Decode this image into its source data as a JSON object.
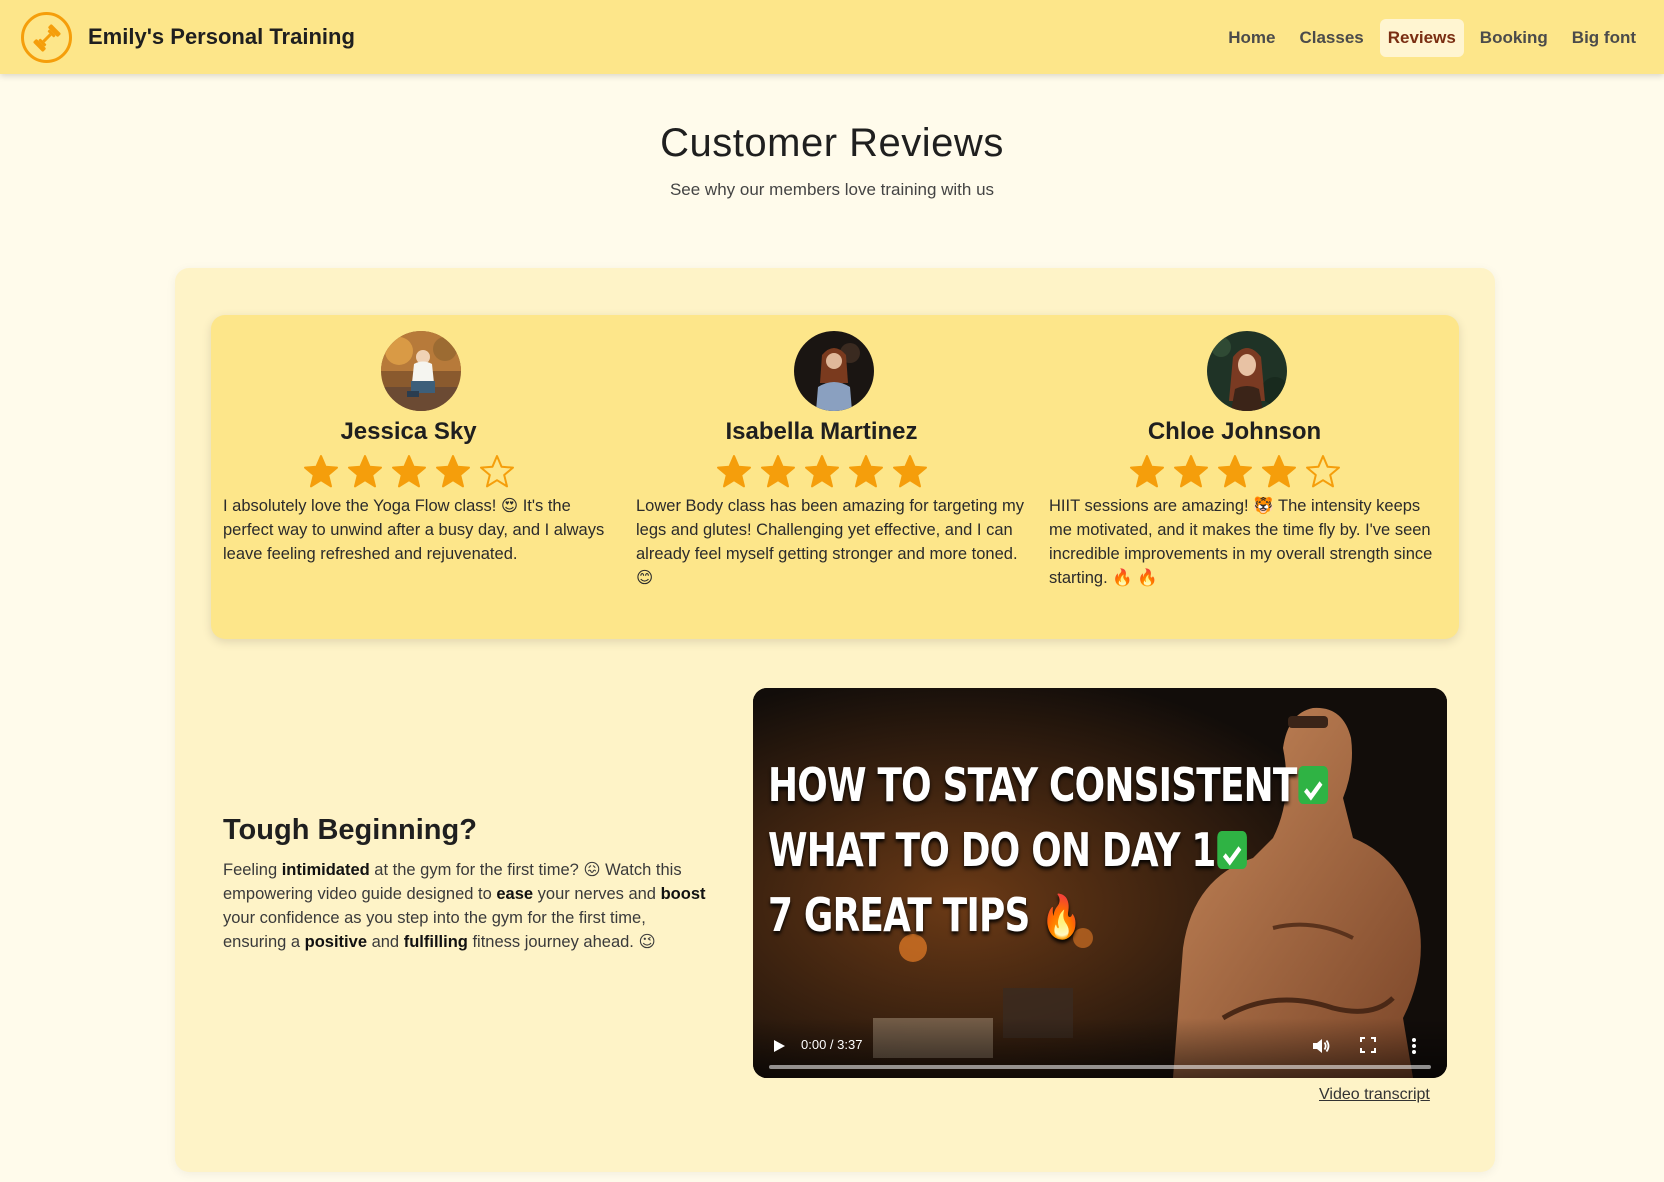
{
  "navbar": {
    "brand": "Emily's Personal Training",
    "links": [
      {
        "label": "Home",
        "active": false
      },
      {
        "label": "Classes",
        "active": false
      },
      {
        "label": "Reviews",
        "active": true
      },
      {
        "label": "Booking",
        "active": false
      },
      {
        "label": "Big font",
        "active": false
      }
    ]
  },
  "header": {
    "title": "Customer Reviews",
    "subtitle": "See why our members love training with us"
  },
  "reviews": [
    {
      "name": "Jessica Sky",
      "rating": 4,
      "max_rating": 5,
      "text": "I absolutely love the Yoga Flow class! 😍 It's the perfect way to unwind after a busy day, and I always leave feeling refreshed and rejuvenated."
    },
    {
      "name": "Isabella Martinez",
      "rating": 5,
      "max_rating": 5,
      "text": "Lower Body class has been amazing for targeting my legs and glutes! Challenging yet effective, and I can already feel myself getting stronger and more toned. 😊"
    },
    {
      "name": "Chloe Johnson",
      "rating": 4,
      "max_rating": 5,
      "text": "HIIT sessions are amazing! 🐯 The intensity keeps me motivated, and it makes the time fly by. I've seen incredible improvements in my overall strength since starting. 🔥 🔥"
    }
  ],
  "tough_beginning": {
    "title": "Tough Beginning?",
    "parts": [
      {
        "t": "Feeling ",
        "b": false
      },
      {
        "t": "intimidated",
        "b": true
      },
      {
        "t": " at the gym for the first time? 😖 Watch this empowering video guide designed to ",
        "b": false
      },
      {
        "t": "ease",
        "b": true
      },
      {
        "t": " your nerves and ",
        "b": false
      },
      {
        "t": "boost",
        "b": true
      },
      {
        "t": " your confidence as you step into the gym for the first time, ensuring a ",
        "b": false
      },
      {
        "t": "positive",
        "b": true
      },
      {
        "t": " and ",
        "b": false
      },
      {
        "t": "fulfilling",
        "b": true
      },
      {
        "t": " fitness journey ahead. 😉",
        "b": false
      }
    ]
  },
  "video": {
    "headlines": [
      "HOW TO STAY CONSISTENT",
      "WHAT TO DO ON DAY 1",
      "7 GREAT TIPS"
    ],
    "time": "0:00 / 3:37",
    "progress": 0
  },
  "transcript_link": "Video transcript",
  "colors": {
    "page_bg": "#fffbeb",
    "navbar_bg": "#fde68a",
    "card_bg": "#fef3c7",
    "star": "#f59e0b",
    "active_nav_text": "#7a2e12"
  }
}
